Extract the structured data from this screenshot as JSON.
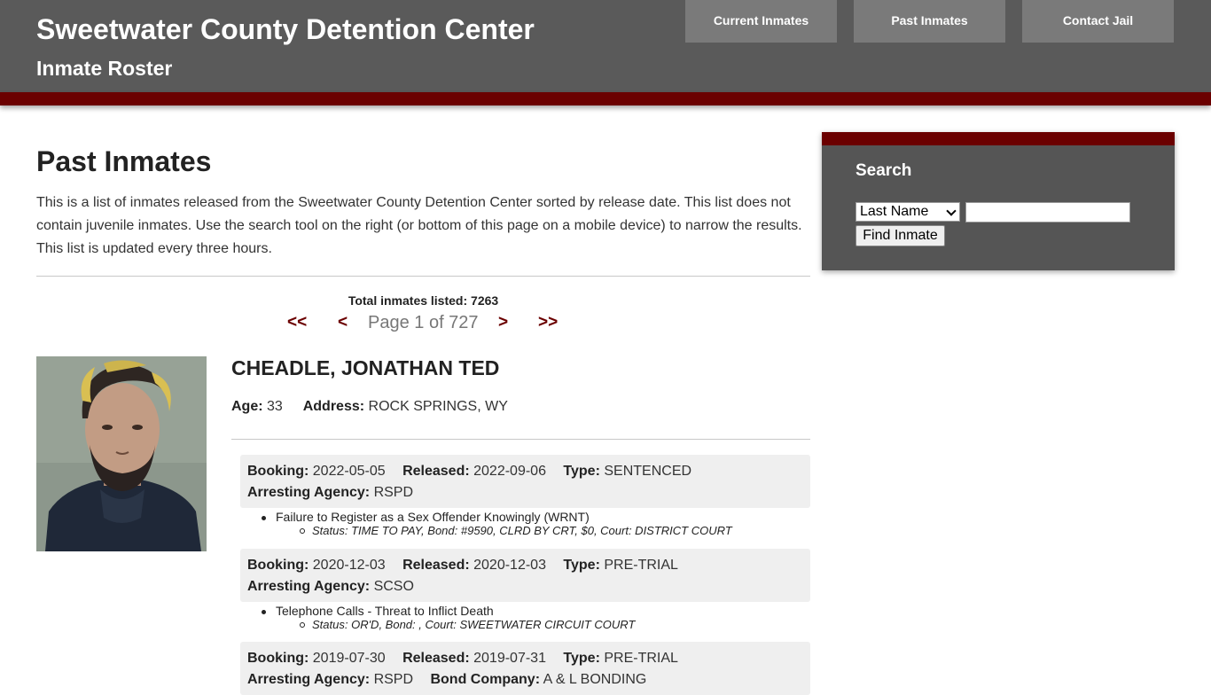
{
  "header": {
    "title": "Sweetwater County Detention Center",
    "subtitle": "Inmate Roster",
    "nav": [
      {
        "label": "Current Inmates"
      },
      {
        "label": "Past Inmates"
      },
      {
        "label": "Contact Jail"
      }
    ]
  },
  "main": {
    "heading": "Past Inmates",
    "intro": "This is a list of inmates released from the Sweetwater County Detention Center sorted by release date. This list does not contain juvenile inmates. Use the search tool on the right (or bottom of this page on a mobile device) to narrow the results. This list is updated every three hours.",
    "total_label": "Total inmates listed:",
    "total_count": "7263",
    "pager": {
      "first": "<<",
      "prev": "<",
      "page_info": "Page 1 of 727",
      "next": ">",
      "last": ">>"
    }
  },
  "inmate": {
    "name": "CHEADLE, JONATHAN TED",
    "age_label": "Age:",
    "age": "33",
    "address_label": "Address:",
    "address": "ROCK SPRINGS, WY",
    "labels": {
      "booking": "Booking:",
      "released": "Released:",
      "type": "Type:",
      "agency": "Arresting Agency:",
      "bond_company": "Bond Company:"
    },
    "bookings": [
      {
        "booking": "2022-05-05",
        "released": "2022-09-06",
        "type": "SENTENCED",
        "agency": "RSPD",
        "charge": "Failure to Register as a Sex Offender Knowingly (WRNT)",
        "status": "Status: TIME TO PAY, Bond: #9590, CLRD BY CRT, $0, Court: DISTRICT COURT"
      },
      {
        "booking": "2020-12-03",
        "released": "2020-12-03",
        "type": "PRE-TRIAL",
        "agency": "SCSO",
        "charge": "Telephone Calls - Threat to Inflict Death",
        "status": "Status: OR'D, Bond: , Court: SWEETWATER CIRCUIT COURT"
      },
      {
        "booking": "2019-07-30",
        "released": "2019-07-31",
        "type": "PRE-TRIAL",
        "agency": "RSPD",
        "bond_company": "A & L BONDING"
      }
    ]
  },
  "sidebar": {
    "title": "Search",
    "select_value": "Last Name",
    "input_value": "",
    "button_label": "Find Inmate"
  },
  "colors": {
    "header_bg": "#5a5a5a",
    "accent": "#6b0000",
    "sidebar_bg": "#555555",
    "booking_bg": "#efefef"
  }
}
